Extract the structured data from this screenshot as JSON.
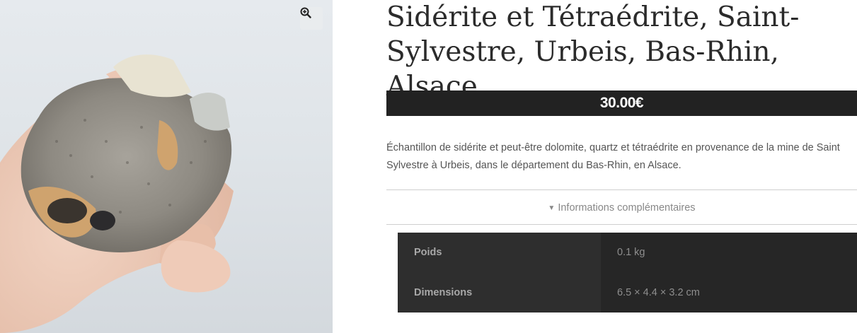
{
  "product": {
    "title": "Sidérite et Tétraédrite, Saint-Sylvestre, Urbeis, Bas-Rhin, Alsace.",
    "price": "30.00€",
    "description": "Échantillon de sidérite et peut-être dolomite, quartz et tétraédrite en provenance de la mine de Saint Sylvestre à Urbeis, dans le département du Bas-Rhin, en Alsace.",
    "image_icon": "zoom-in-icon"
  },
  "accordion": {
    "label": "Informations complémentaires",
    "icon": "chevron-down-icon"
  },
  "attributes": [
    {
      "label": "Poids",
      "value": "0.1 kg"
    },
    {
      "label": "Dimensions",
      "value": "6.5 × 4.4 × 3.2 cm"
    }
  ],
  "colors": {
    "price_bar": "#222222",
    "table_header": "#2e2e2e",
    "table_cell": "#262626"
  }
}
